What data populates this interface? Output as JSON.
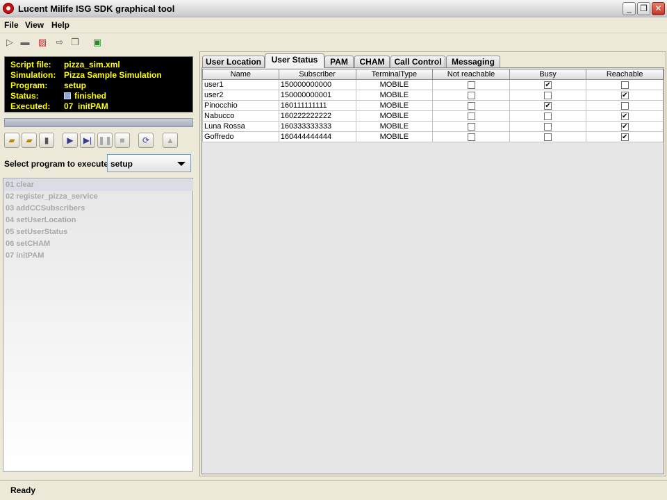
{
  "window": {
    "title": "Lucent Milife ISG SDK graphical tool",
    "min_glyph": "_",
    "max_glyph": "❐",
    "close_glyph": "✕"
  },
  "menu": {
    "file": "File",
    "view": "View",
    "help": "Help"
  },
  "toolbar": {
    "icons": [
      "run-icon",
      "computer-icon",
      "disconnect-icon",
      "export-icon",
      "settings-file-icon",
      "help-icon"
    ]
  },
  "info": {
    "script_label": "Script file:",
    "script_value": "pizza_sim.xml",
    "simulation_label": "Simulation:",
    "simulation_value": "Pizza Sample Simulation",
    "program_label": "Program:",
    "program_value": "setup",
    "status_label": "Status:",
    "status_value": "finished",
    "executed_label": "Executed:",
    "executed_value": "07  initPAM"
  },
  "controls": {
    "select_label": "Select program to execute:",
    "selected_program": "setup"
  },
  "programs": [
    "01  clear",
    "02  register_pizza_service",
    "03  addCCSubscribers",
    "04  setUserLocation",
    "05  setUserStatus",
    "06  setCHAM",
    "07  initPAM"
  ],
  "tabs": [
    "User Location",
    "User Status",
    "PAM",
    "CHAM",
    "Call Control",
    "Messaging"
  ],
  "active_tab": "User Status",
  "table": {
    "headers": [
      "Name",
      "Subscriber",
      "TerminalType",
      "Not reachable",
      "Busy",
      "Reachable"
    ],
    "rows": [
      {
        "name": "user1",
        "subscriber": "150000000000",
        "terminal": "MOBILE",
        "not_reachable": false,
        "busy": true,
        "reachable": false
      },
      {
        "name": "user2",
        "subscriber": "150000000001",
        "terminal": "MOBILE",
        "not_reachable": false,
        "busy": false,
        "reachable": true
      },
      {
        "name": "Pinocchio",
        "subscriber": "160111111111",
        "terminal": "MOBILE",
        "not_reachable": false,
        "busy": true,
        "reachable": false
      },
      {
        "name": "Nabucco",
        "subscriber": "160222222222",
        "terminal": "MOBILE",
        "not_reachable": false,
        "busy": false,
        "reachable": true
      },
      {
        "name": "Luna Rossa",
        "subscriber": "160333333333",
        "terminal": "MOBILE",
        "not_reachable": false,
        "busy": false,
        "reachable": true
      },
      {
        "name": "Goffredo",
        "subscriber": "160444444444",
        "terminal": "MOBILE",
        "not_reachable": false,
        "busy": false,
        "reachable": true
      }
    ]
  },
  "status_bar": {
    "text": "Ready"
  }
}
